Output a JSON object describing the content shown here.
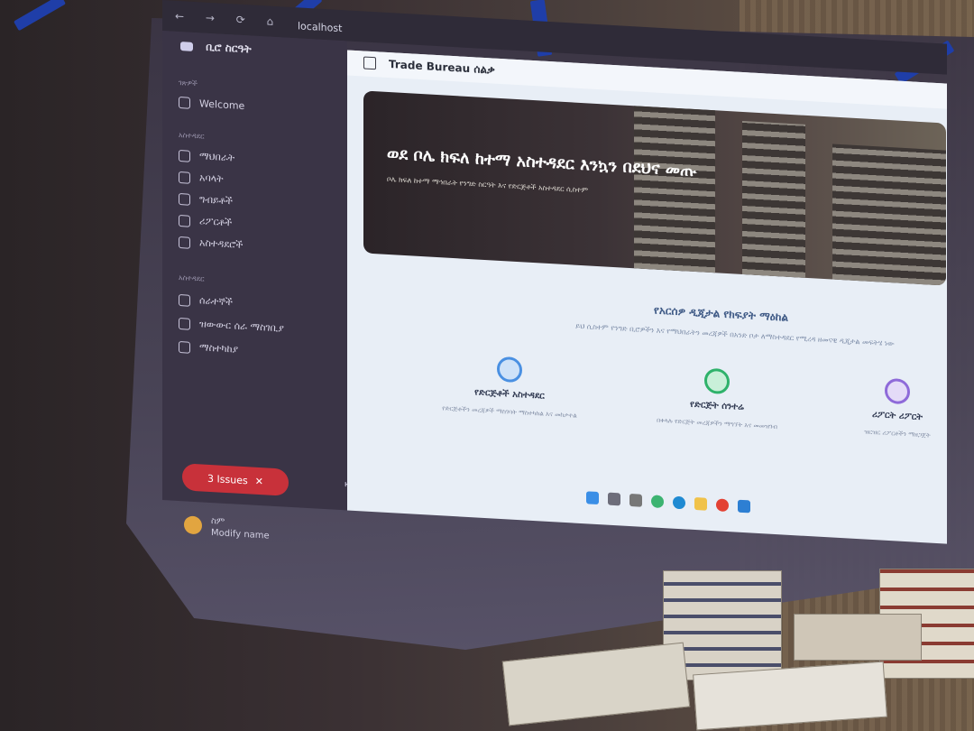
{
  "browser": {
    "url": "localhost",
    "nav_icons": "← → ⟳ ⌂"
  },
  "sidebar": {
    "brand": "ቢሮ ስርዓት",
    "sections": [
      {
        "label": "ገጽዎች"
      },
      {
        "label": "አስተዳደር"
      },
      {
        "label": "አስተዳደር"
      }
    ],
    "items": [
      {
        "label": "Welcome",
        "icon": "home-icon"
      },
      {
        "label": "ማህበራት",
        "icon": "list-icon"
      },
      {
        "label": "አባላት",
        "icon": "users-icon"
      },
      {
        "label": "ግብይቶች",
        "icon": "cart-icon"
      },
      {
        "label": "ሪፖርቶች",
        "icon": "chart-icon"
      },
      {
        "label": "አስተዳደሮች",
        "icon": "user-icon"
      },
      {
        "label": "ሰራተኞች",
        "icon": "group-icon"
      },
      {
        "label": "ዝውውር ሰራ ማስገቢያ",
        "icon": "transfer-icon"
      },
      {
        "label": "ማስተካከያ",
        "icon": "settings-icon"
      }
    ],
    "issues_label": "3 Issues",
    "logout_icon": "logout-icon",
    "user": {
      "name": "ስም",
      "role": "Modify name"
    }
  },
  "main": {
    "page_title": "Trade Bureau ሰልቃ",
    "hero": {
      "title": "ወደ ቦሌ ክፍለ ከተማ አስተዳደር እንኳን በደህና መጡ",
      "subtitle": "ቦሌ ክፍለ ከተማ ማኅበራት የንግድ ስርዓት እና የድርጅቶች አስተዳደር ሲስተም"
    },
    "section_title": "የአርሰዎ ዲጂታል የክፍያት ማዕከል",
    "section_desc": "ይህ ሲስተም የንግድ ቢሮዎችን እና የማህበራትን መረጃዎች በአንድ ቦታ ለማስተዳደር የሚረዳ ዘመናዊ ዲጂታል መፍትሄ ነው",
    "cards": [
      {
        "title": "የድርጅቶች አስተዳደር",
        "desc": "የድርጅቶችን መረጃዎች ማስገባት ማስተካከል እና መከታተል",
        "color": "#4a90e2"
      },
      {
        "title": "የድርጅት ሰንተሬ",
        "desc": "በቀላሉ የድርጅት መረጃዎችን ማግኘት እና መመዝገብ",
        "color": "#2fb26b"
      },
      {
        "title": "ሪፖርት ሪፖርት",
        "desc": "ዝርዝር ሪፖርቶችን ማዘጋጀት",
        "color": "#8e6ad9"
      }
    ]
  },
  "colors": {
    "accent_red": "#c8313a",
    "sidebar_bg": "#3a3446",
    "content_bg": "#e8eef6"
  }
}
